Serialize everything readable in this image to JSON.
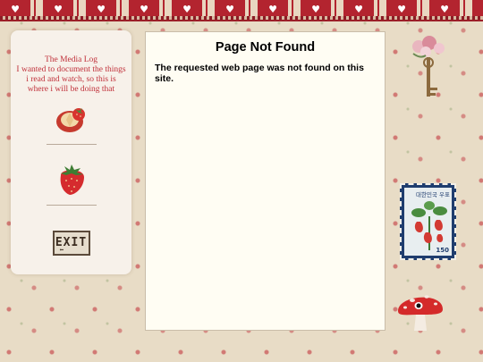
{
  "sidebar": {
    "title": "The Media Log",
    "description": "I wanted to document the things i read and watch, so this is where i will be doing that",
    "icons": {
      "cake": "strawberry-cake-icon",
      "strawberry": "strawberry-icon",
      "exit": "exit-sign-icon"
    },
    "exit_label": "EXIT"
  },
  "main": {
    "title": "Page Not Found",
    "message": "The requested web page was not found on this site."
  },
  "decor": {
    "stamp_text": "대한민국 우표",
    "stamp_value": "150"
  },
  "colors": {
    "accent": "#c0303a",
    "band": "#b3242f",
    "background": "#e8dcc6",
    "panel": "#fffdf3"
  }
}
